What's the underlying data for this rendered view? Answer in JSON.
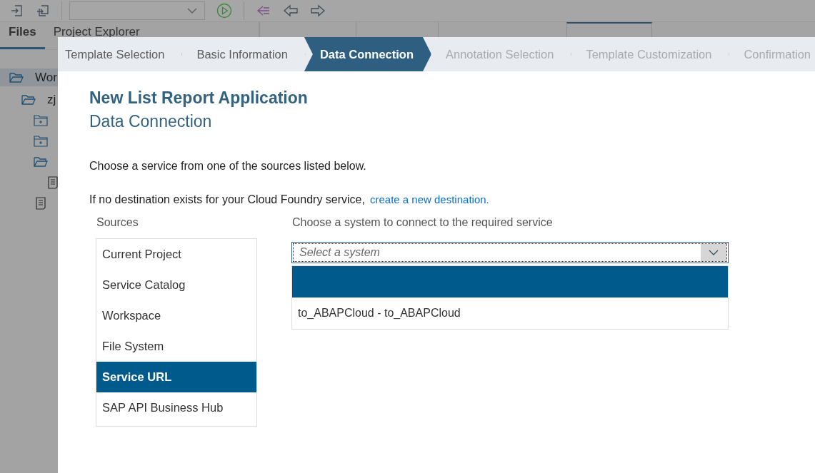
{
  "side_tabs": [
    {
      "label": "Files",
      "selected": true
    },
    {
      "label": "Project Explorer",
      "selected": false
    }
  ],
  "editor_tabs": [
    {
      "selected": false
    },
    {
      "selected": false
    },
    {
      "selected": false
    },
    {
      "selected": true
    }
  ],
  "tree": [
    {
      "label": "Wor",
      "kind": "folder",
      "expanded": true,
      "selected": true,
      "children": [
        {
          "label": "zj",
          "kind": "folder",
          "expanded": true,
          "selected": false,
          "children": [
            {
              "kind": "folder",
              "expanded": false,
              "selected": false
            },
            {
              "kind": "folder",
              "expanded": false,
              "selected": false
            },
            {
              "kind": "folder",
              "expanded": true,
              "selected": false,
              "children": [
                {
                  "kind": "file",
                  "selected": false
                }
              ]
            },
            {
              "kind": "file",
              "selected": false
            }
          ]
        }
      ]
    }
  ],
  "wizard": {
    "steps": [
      {
        "label": "Template Selection",
        "selected": false,
        "disabled": false
      },
      {
        "label": "Basic Information",
        "selected": false,
        "disabled": false
      },
      {
        "label": "Data Connection",
        "selected": true,
        "disabled": false
      },
      {
        "label": "Annotation Selection",
        "selected": false,
        "disabled": true
      },
      {
        "label": "Template Customization",
        "selected": false,
        "disabled": true
      },
      {
        "label": "Confirmation",
        "selected": false,
        "disabled": true
      }
    ],
    "title": "New List Report Application",
    "subtitle": "Data Connection",
    "intro": "Choose a service from one of the sources listed below.",
    "note": "If no destination exists for your Cloud Foundry service,",
    "note_link": "create a new destination.",
    "sources_label": "Sources",
    "sources": [
      {
        "label": "Current Project",
        "selected": false
      },
      {
        "label": "Service Catalog",
        "selected": false
      },
      {
        "label": "Workspace",
        "selected": false
      },
      {
        "label": "File System",
        "selected": false
      },
      {
        "label": "Service URL",
        "selected": true
      },
      {
        "label": "SAP API Business Hub",
        "selected": false
      }
    ],
    "system_label": "Choose a system to connect to the required service",
    "system_select": {
      "placeholder": "Select a system",
      "expanded": true,
      "options": [
        {
          "selected": true
        },
        {
          "label": "to_ABAPCloud - to_ABAPCloud",
          "selected": false
        }
      ]
    }
  }
}
